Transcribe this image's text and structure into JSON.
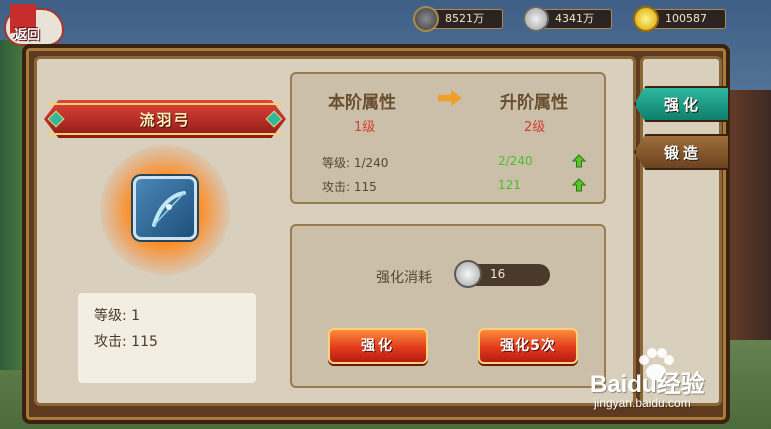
{
  "top_bar": {
    "back_label": "返回",
    "resources": [
      {
        "icon": "power-icon",
        "value": "8521万"
      },
      {
        "icon": "silver-coin-icon",
        "value": "4341万"
      },
      {
        "icon": "gold-ingot-icon",
        "value": "100587"
      }
    ]
  },
  "tabs": [
    {
      "label": "强化",
      "active": true
    },
    {
      "label": "锻造",
      "active": false
    }
  ],
  "item": {
    "name": "流羽弓",
    "icon": "bow-icon",
    "stats": {
      "level": "等级: 1",
      "attack": "攻击: 115"
    }
  },
  "attributes": {
    "current_title": "本阶属性",
    "next_title": "升阶属性",
    "current_level": "1级",
    "next_level": "2级",
    "current_stats": [
      "等级: 1/240",
      "攻击: 115"
    ],
    "next_stats": [
      "2/240",
      "121"
    ]
  },
  "cost": {
    "label": "强化消耗",
    "value": "16",
    "icon": "silver-coin-icon"
  },
  "buttons": {
    "enhance": "强化",
    "enhance_5": "强化5次"
  },
  "watermark": {
    "brand": "Baidu经验",
    "url": "jingyan.baidu.com"
  },
  "colors": {
    "active_tab": "#1f9c86",
    "button": "#e03b1c",
    "level_text": "#d0412f",
    "upgrade_text": "#4cbf2a"
  }
}
